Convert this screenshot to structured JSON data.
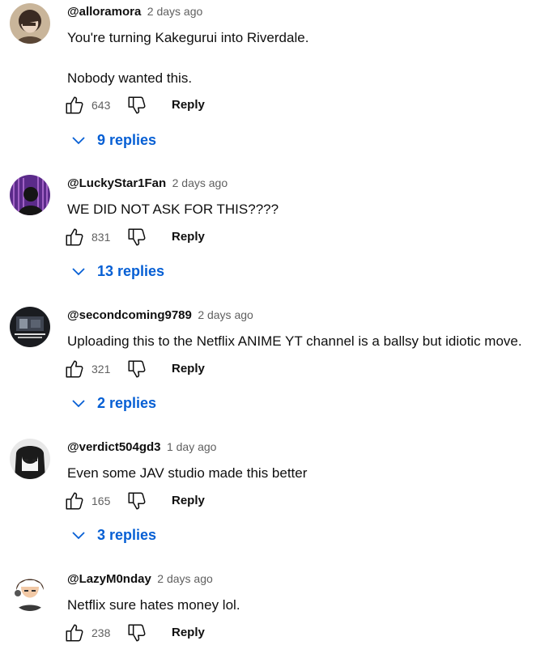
{
  "colors": {
    "link": "#065fd4",
    "secondary": "#606060",
    "text": "#0f0f0f"
  },
  "comments": [
    {
      "author": "@alloramora",
      "time": "2 days ago",
      "lines": [
        "You're turning Kakegurui into Riverdale.",
        "Nobody wanted this."
      ],
      "likes": "643",
      "reply_label": "Reply",
      "replies_label": "9 replies"
    },
    {
      "author": "@LuckyStar1Fan",
      "time": "2 days ago",
      "lines": [
        "WE DID NOT ASK FOR THIS????"
      ],
      "likes": "831",
      "reply_label": "Reply",
      "replies_label": "13 replies"
    },
    {
      "author": "@secondcoming9789",
      "time": "2 days ago",
      "lines": [
        "Uploading this to the Netflix ANIME YT channel is a ballsy but idiotic move."
      ],
      "likes": "321",
      "reply_label": "Reply",
      "replies_label": "2 replies"
    },
    {
      "author": "@verdict504gd3",
      "time": "1 day ago",
      "lines": [
        "Even some JAV studio made this better"
      ],
      "likes": "165",
      "reply_label": "Reply",
      "replies_label": "3 replies"
    },
    {
      "author": "@LazyM0nday",
      "time": "2 days ago",
      "lines": [
        "Netflix sure hates money lol."
      ],
      "likes": "238",
      "reply_label": "Reply"
    }
  ]
}
